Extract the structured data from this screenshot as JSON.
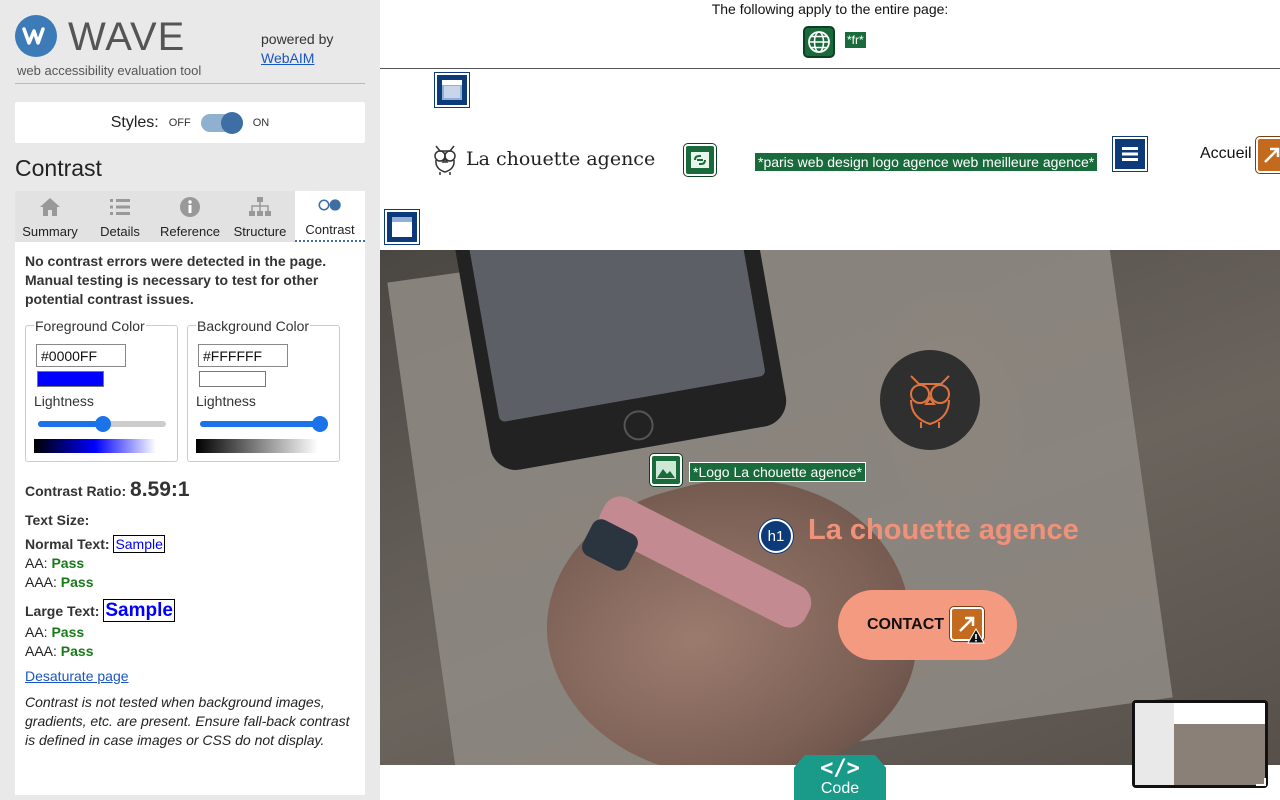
{
  "sidebar": {
    "app_title": "WAVE",
    "app_subtitle": "web accessibility evaluation tool",
    "powered_by": "powered by",
    "powered_link": "WebAIM",
    "styles_label": "Styles:",
    "styles_off": "OFF",
    "styles_on": "ON",
    "section_title": "Contrast",
    "tabs": [
      {
        "label": "Summary",
        "icon": "home-icon"
      },
      {
        "label": "Details",
        "icon": "list-icon"
      },
      {
        "label": "Reference",
        "icon": "info-icon"
      },
      {
        "label": "Structure",
        "icon": "hierarchy-icon"
      },
      {
        "label": "Contrast",
        "icon": "contrast-icon",
        "active": true
      }
    ],
    "contrast": {
      "message": "No contrast errors were detected in the page. Manual testing is necessary to test for other potential contrast issues.",
      "foreground": {
        "legend": "Foreground Color",
        "hex": "#0000FF",
        "swatch": "#0000ff",
        "lightness_label": "Lightness",
        "lightness": 0.5
      },
      "background": {
        "legend": "Background Color",
        "hex": "#FFFFFF",
        "swatch": "#ffffff",
        "lightness_label": "Lightness",
        "lightness": 1.0
      },
      "ratio_label": "Contrast Ratio:",
      "ratio_value": "8.59:1",
      "text_size_label": "Text Size:",
      "normal_label": "Normal Text:",
      "large_label": "Large Text:",
      "sample": "Sample",
      "aa_label": "AA:",
      "aaa_label": "AAA:",
      "normal_aa": "Pass",
      "normal_aaa": "Pass",
      "large_aa": "Pass",
      "large_aaa": "Pass",
      "desaturate_link": "Desaturate page",
      "note": "Contrast is not tested when background images, gradients, etc. are present. Ensure fall-back contrast is defined in case images or CSS do not display."
    }
  },
  "page": {
    "global_notice": "The following apply to the entire page:",
    "lang_tag": "*fr*",
    "site_name": "La chouette agence",
    "logo_alt_tag": "*paris web design logo agence web meilleure agence*",
    "nav_item": "Accueil",
    "hero_logo_alt_tag": "*Logo La chouette agence*",
    "h1_badge": "h1",
    "hero_title": "La chouette agence",
    "contact_button": "CONTACT",
    "code_button": "Code",
    "code_symbol": "</>"
  },
  "colors": {
    "wave_blue": "#3d7ab8",
    "wave_green": "#1a6b3c",
    "wave_navy": "#0d3b7a",
    "alert_orange": "#c46a1e",
    "hero_accent": "#f0927a",
    "pass_green": "#1a7a1a",
    "code_teal": "#1a9b8a"
  }
}
